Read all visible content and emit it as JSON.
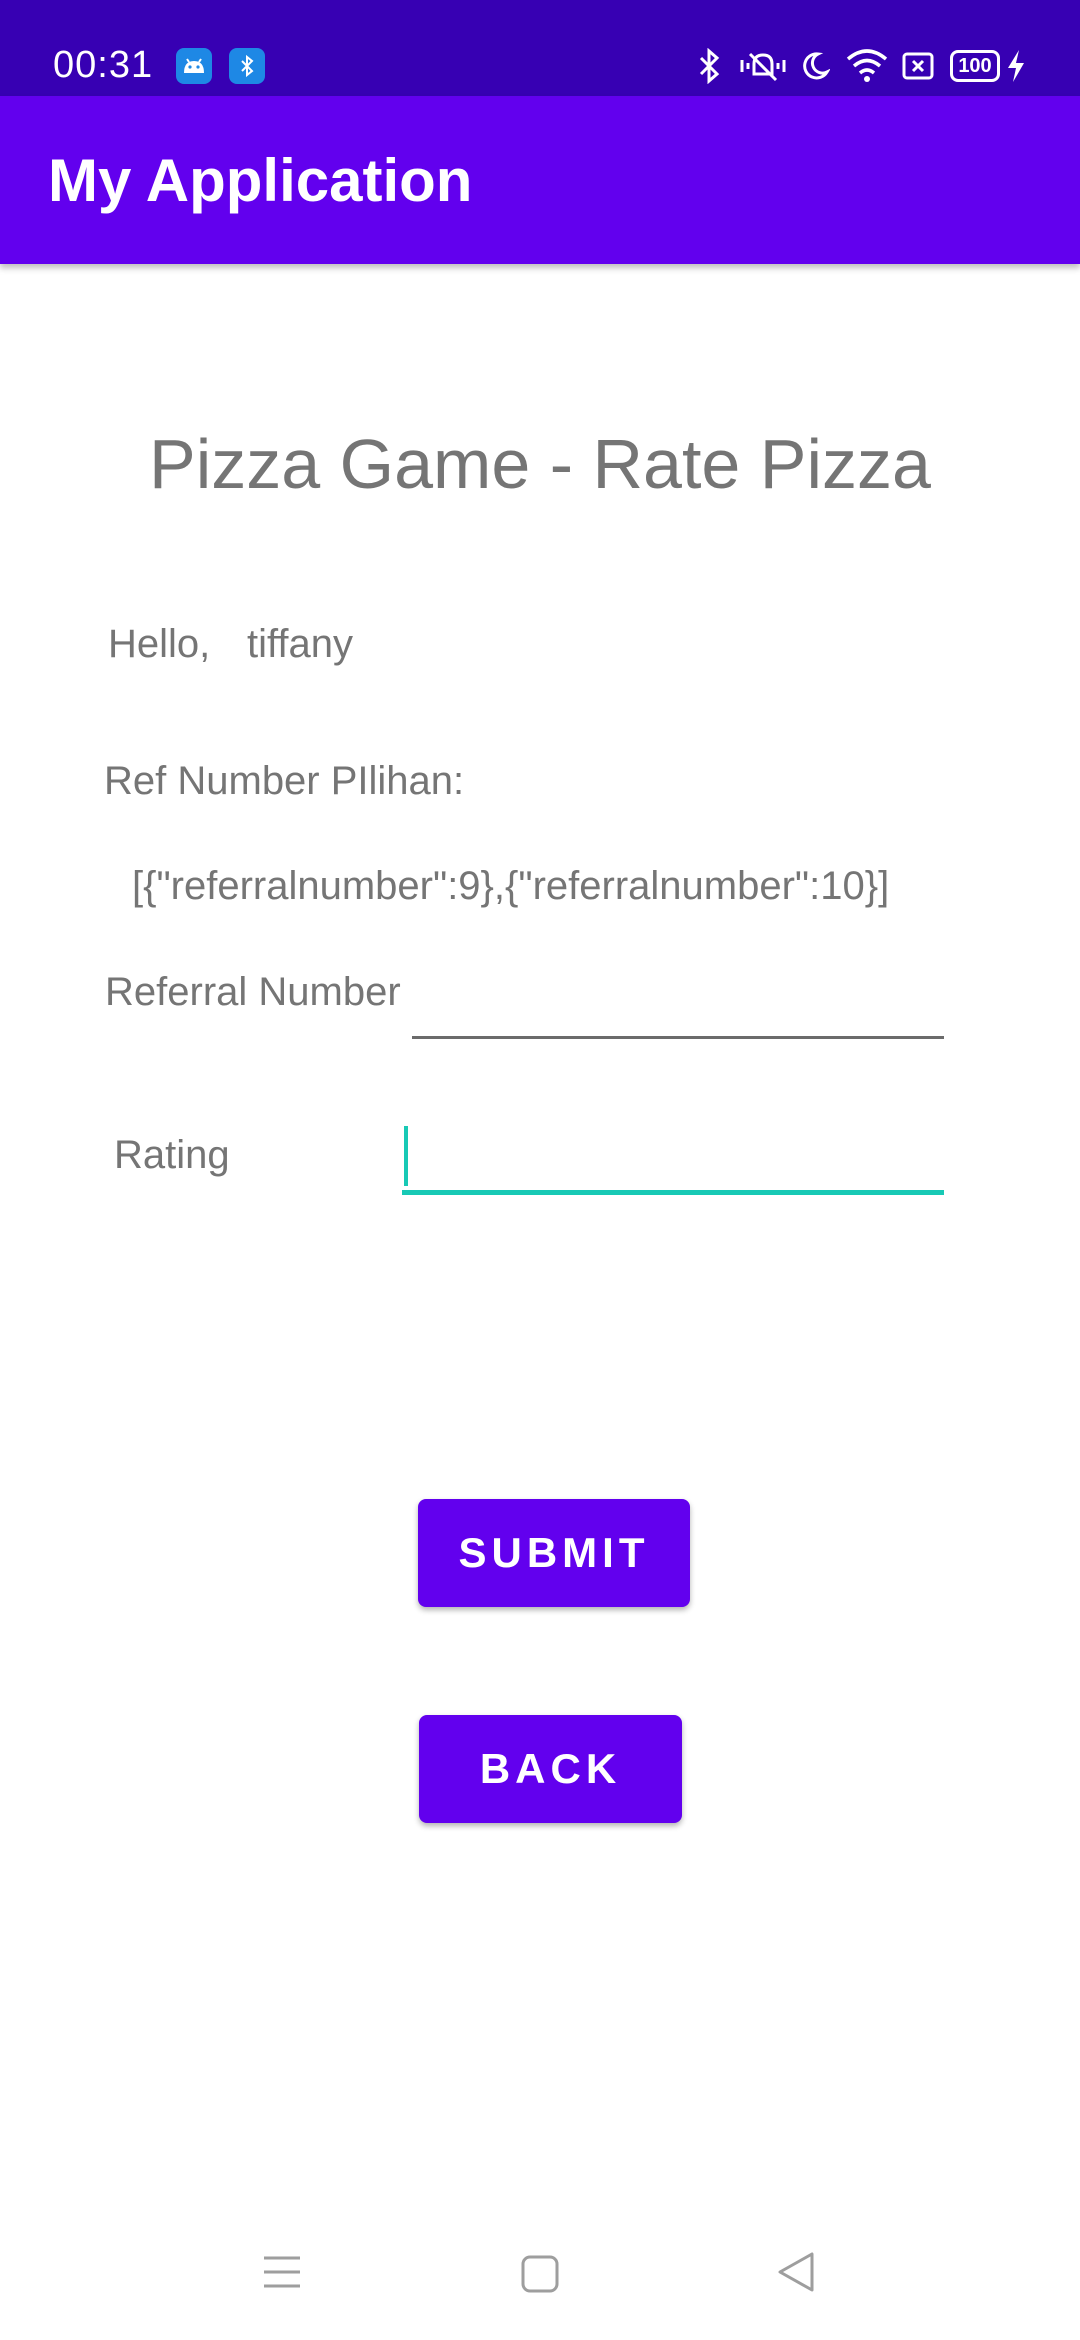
{
  "status_bar": {
    "time": "00:31",
    "battery": "100",
    "icons": [
      "android-icon",
      "bluetooth-notification-icon",
      "bluetooth-icon",
      "vibrate-icon",
      "moon-icon",
      "wifi-icon",
      "screenshot-icon",
      "battery-icon",
      "charging-icon"
    ]
  },
  "app_bar": {
    "title": "My Application"
  },
  "main": {
    "title": "Pizza Game - Rate Pizza",
    "greeting_prefix": "Hello,",
    "username": "tiffany",
    "ref_label": "Ref Number PIlihan:",
    "ref_value": "[{\"referralnumber\":9},{\"referralnumber\":10}]",
    "referral_label": "Referral Number",
    "referral_value": "",
    "rating_label": "Rating",
    "rating_value": ""
  },
  "buttons": {
    "submit": "SUBMIT",
    "back": "BACK"
  },
  "nav_bar": {
    "icons": [
      "menu-icon",
      "home-icon",
      "back-icon"
    ]
  },
  "colors": {
    "status_bar": "#3700b3",
    "primary": "#6200ee",
    "accent": "#18c9b5",
    "text_secondary": "#757575"
  }
}
